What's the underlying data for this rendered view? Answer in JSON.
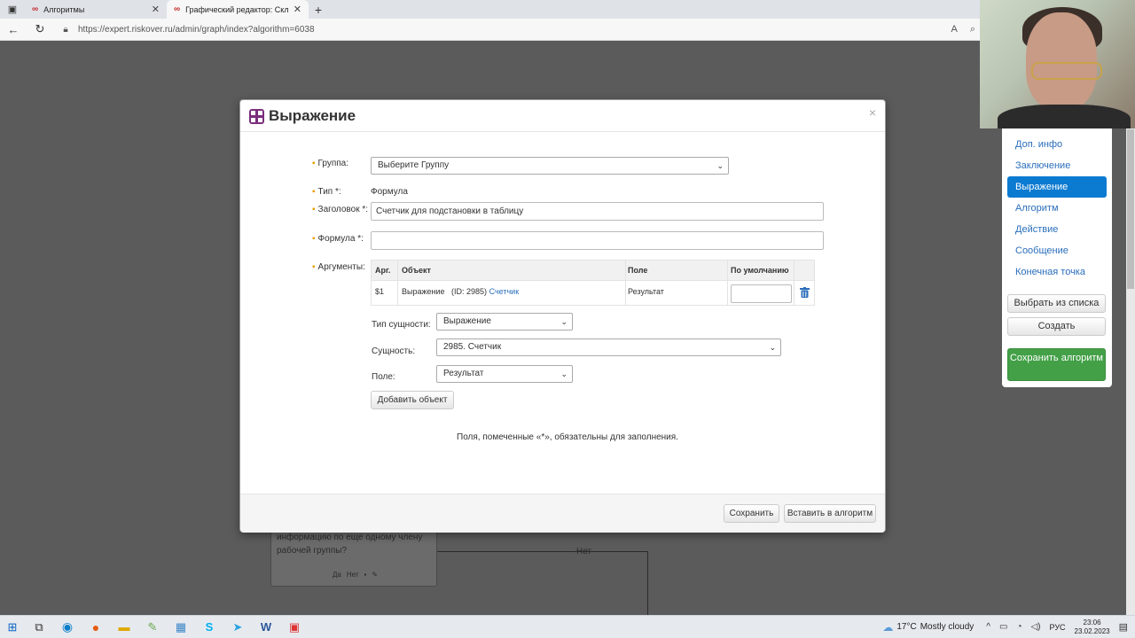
{
  "browser": {
    "tabs": [
      {
        "title": "Алгоритмы",
        "active": false
      },
      {
        "title": "Графический редактор: Склоне",
        "active": true
      }
    ],
    "url": "https://expert.riskover.ru/admin/graph/index?algorithm=6038"
  },
  "background": {
    "node_text": "информацию по еще одному члену рабочей группы?",
    "node_actions": [
      "Да",
      "Нет"
    ],
    "edge_label": "Нет"
  },
  "right_panel": {
    "items": [
      {
        "label": "Доп. инфо",
        "active": false
      },
      {
        "label": "Заключение",
        "active": false
      },
      {
        "label": "Выражение",
        "active": true
      },
      {
        "label": "Алгоритм",
        "active": false
      },
      {
        "label": "Действие",
        "active": false
      },
      {
        "label": "Сообщение",
        "active": false
      },
      {
        "label": "Конечная точка",
        "active": false
      }
    ],
    "choose_btn": "Выбрать из списка",
    "create_btn": "Создать",
    "save_btn": "Сохранить алгоритм"
  },
  "modal": {
    "title": "Выражение",
    "group_label": "Группа:",
    "group_value": "Выберите Группу",
    "type_label": "Тип *:",
    "type_value": "Формула",
    "heading_label": "Заголовок *:",
    "heading_value": "Счетчик для подстановки в таблицу",
    "formula_label": "Формула *:",
    "formula_value": "",
    "args_label": "Аргументы:",
    "args_columns": [
      "Арг.",
      "Объект",
      "Поле",
      "По умолчанию"
    ],
    "args_rows": [
      {
        "arg": "$1",
        "object_type": "Выражение",
        "object_id": "(ID: 2985)",
        "object_link": "Счетчик",
        "field": "Результат",
        "default": ""
      }
    ],
    "entity_type_label": "Тип сущности:",
    "entity_type_value": "Выражение",
    "entity_label": "Сущность:",
    "entity_value": "2985. Счетчик",
    "field_label": "Поле:",
    "field_value": "Результат",
    "add_object_btn": "Добавить объект",
    "required_note": "Поля, помеченные «*», обязательны для заполнения.",
    "save_btn": "Сохранить",
    "insert_btn": "Вставить в алгоритм",
    "close": "×"
  },
  "taskbar": {
    "weather_temp": "17°C",
    "weather_text": "Mostly cloudy",
    "lang": "РУС",
    "time": "23:06",
    "date": "23.02.2023"
  },
  "colors": {
    "accent": "#0b7ad1",
    "green": "#43a047",
    "required": "#e6a100",
    "link": "#2a6ebb"
  }
}
